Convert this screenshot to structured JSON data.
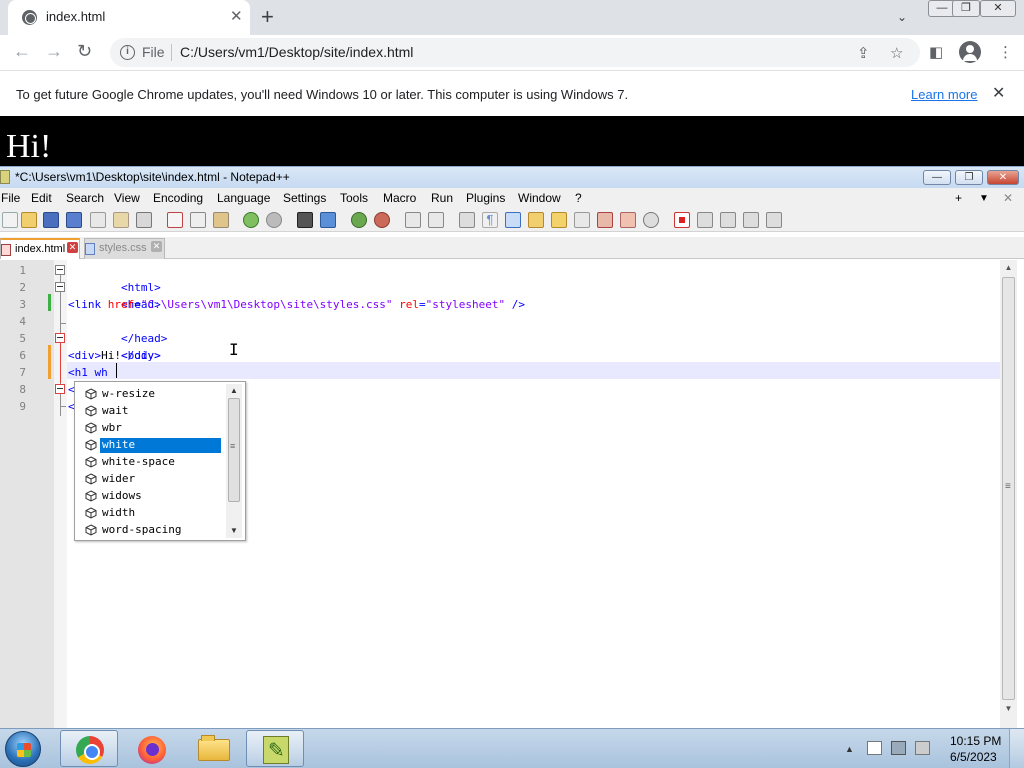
{
  "chrome": {
    "tab": {
      "title": "index.html",
      "close": "✕"
    },
    "new_tab": "+",
    "tab_search": "⌄",
    "window_buttons": {
      "minimize": "—",
      "restore": "❐",
      "close": "✕"
    },
    "nav": {
      "back": "←",
      "forward": "→",
      "reload": "↻"
    },
    "omnibox": {
      "info": "i",
      "scheme": "File",
      "url": "C:/Users/vm1/Desktop/site/index.html",
      "share": "⇪",
      "bookmark": "☆"
    },
    "toolbar": {
      "sidepanel": "◧",
      "menu": "⋮"
    },
    "infobar": {
      "message": "To get future Google Chrome updates, you'll need Windows 10 or later. This computer is using Windows 7.",
      "link": "Learn more",
      "close": "✕"
    },
    "page": {
      "heading": "Hi!"
    }
  },
  "npp": {
    "title": "*C:\\Users\\vm1\\Desktop\\site\\index.html - Notepad++",
    "window_buttons": {
      "minimize": "—",
      "restore": "❐",
      "close": "✕"
    },
    "menu": [
      "File",
      "Edit",
      "Search",
      "View",
      "Encoding",
      "Language",
      "Settings",
      "Tools",
      "Macro",
      "Run",
      "Plugins",
      "Window",
      "?"
    ],
    "menu_right": {
      "plus": "+",
      "dropdown": "▼",
      "close": "✕"
    },
    "tabs": [
      {
        "label": "index.html",
        "close": "✕"
      },
      {
        "label": "styles.css",
        "close": "✕"
      }
    ],
    "line_numbers": [
      "1",
      "2",
      "3",
      "4",
      "5",
      "6",
      "7",
      "8",
      "9"
    ],
    "code": {
      "line1": "<html>",
      "line2": "<head>",
      "line3": {
        "open": "<link ",
        "attr1": "href",
        "eq1": "=",
        "val1": "\"C:\\Users\\vm1\\Desktop\\site\\styles.css\"",
        "sp": " ",
        "attr2": "rel",
        "eq2": "=",
        "val2": "\"stylesheet\"",
        "close": " />"
      },
      "line4": "</head>",
      "line5": "<body>",
      "line6": {
        "open": "<div>",
        "text": "Hi!",
        "close": "</div>"
      },
      "line7": {
        "tag": "<h1 ",
        "attr": "wh"
      },
      "line8_frag": "<",
      "line9_frag": "<"
    },
    "autocomplete": {
      "items": [
        "w-resize",
        "wait",
        "wbr",
        "white",
        "white-space",
        "wider",
        "widows",
        "width",
        "word-spacing"
      ],
      "selected_index": 3,
      "scroll_up": "▲",
      "scroll_down": "▼"
    },
    "scrollbar": {
      "up": "▲",
      "down": "▼"
    }
  },
  "taskbar": {
    "tray": {
      "show_hidden": "▲"
    },
    "clock": {
      "time": "10:15 PM",
      "date": "6/5/2023"
    }
  },
  "colors": {
    "tag": "#0000ff",
    "attribute": "#ff0000",
    "value": "#8000ff",
    "selection": "#0078d7",
    "current_line": "#e8e8ff"
  }
}
